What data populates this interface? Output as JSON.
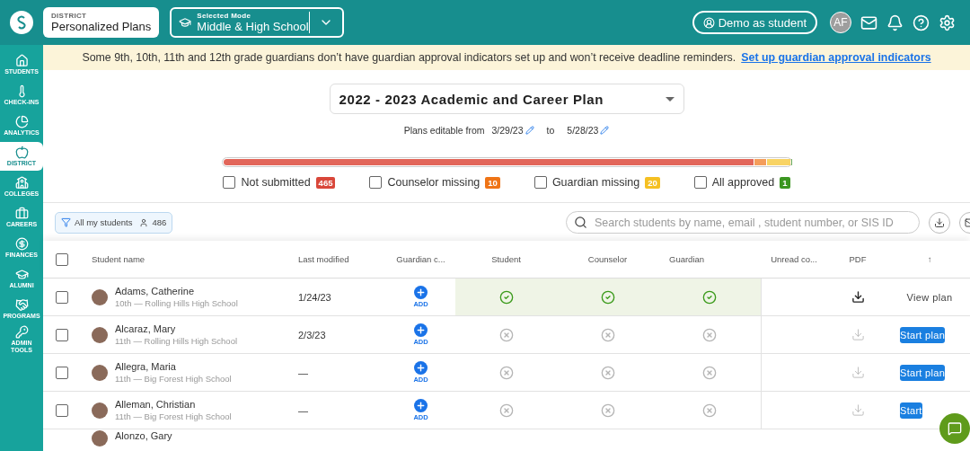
{
  "topbar": {
    "district_label": "DISTRICT",
    "app_title": "Personalized Plans",
    "mode_label": "Selected Mode",
    "mode_value": "Middle & High School",
    "demo_button": "Demo as student",
    "avatar_initials": "AF"
  },
  "sidebar": {
    "items": [
      {
        "label": "STUDENTS",
        "selected": false
      },
      {
        "label": "CHECK-INS",
        "selected": false
      },
      {
        "label": "ANALYTICS",
        "selected": false
      },
      {
        "label": "DISTRICT",
        "selected": true
      },
      {
        "label": "COLLEGES",
        "selected": false
      },
      {
        "label": "CAREERS",
        "selected": false
      },
      {
        "label": "FINANCES",
        "selected": false
      },
      {
        "label": "ALUMNI",
        "selected": false
      },
      {
        "label": "PROGRAMS",
        "selected": false
      },
      {
        "label": "ADMIN TOOLS",
        "selected": false
      }
    ]
  },
  "banner": {
    "text": "Some 9th, 10th, 11th and 12th grade guardians don’t have guardian approval indicators set up and won’t receive deadline reminders.",
    "link": "Set up guardian approval indicators"
  },
  "plan_select": {
    "value": "2022 - 2023 Academic and Career Plan"
  },
  "editable": {
    "label": "Plans editable from",
    "start": "3/29/23",
    "to": "to",
    "end": "5/28/23"
  },
  "progress": {
    "level": 0.936
  },
  "filters": [
    {
      "label": "Not submitted",
      "count": "465",
      "color": "#d9473a",
      "checked": false
    },
    {
      "label": "Counselor missing",
      "count": "10",
      "color": "#ef7416",
      "checked": false
    },
    {
      "label": "Guardian missing",
      "count": "20",
      "color": "#f5c022",
      "checked": false
    },
    {
      "label": "All approved",
      "count": "1",
      "color": "#3b9620",
      "checked": false
    }
  ],
  "toolbar": {
    "chip_label": "All my students",
    "chip_count": "486",
    "search_placeholder": "Search students by name, email , student number, or SIS ID"
  },
  "table": {
    "select_all": false,
    "columns": [
      "Student name",
      "Last modified",
      "Guardian c...",
      "Student",
      "Counselor",
      "Guardian",
      "Unread co...",
      "PDF",
      "↑"
    ],
    "rows": [
      {
        "checked": false,
        "name": "Adams, Catherine",
        "detail": "10th — Rolling Hills High School",
        "modified": "1/24/23",
        "add": "ADD",
        "student": true,
        "counselor": true,
        "guardian": true,
        "pdf_ready": true,
        "action": {
          "kind": "link",
          "label": "View plan"
        }
      },
      {
        "checked": false,
        "name": "Alcaraz, Mary",
        "detail": "11th — Rolling Hills High School",
        "modified": "2/3/23",
        "add": "ADD",
        "student": false,
        "counselor": false,
        "guardian": false,
        "pdf_ready": false,
        "action": {
          "kind": "button",
          "label": "Start plan"
        }
      },
      {
        "checked": false,
        "name": "Allegra, Maria",
        "detail": "11th — Big Forest High School",
        "modified": "—",
        "add": "ADD",
        "student": false,
        "counselor": false,
        "guardian": false,
        "pdf_ready": false,
        "action": {
          "kind": "button",
          "label": "Start plan"
        }
      },
      {
        "checked": false,
        "name": "Alleman, Christian",
        "detail": "11th — Big Forest High School",
        "modified": "—",
        "add": "ADD",
        "student": false,
        "counselor": false,
        "guardian": false,
        "pdf_ready": false,
        "action": {
          "kind": "button",
          "label": "Start"
        }
      }
    ],
    "partial_row": {
      "name": "Alonzo, Gary"
    }
  }
}
